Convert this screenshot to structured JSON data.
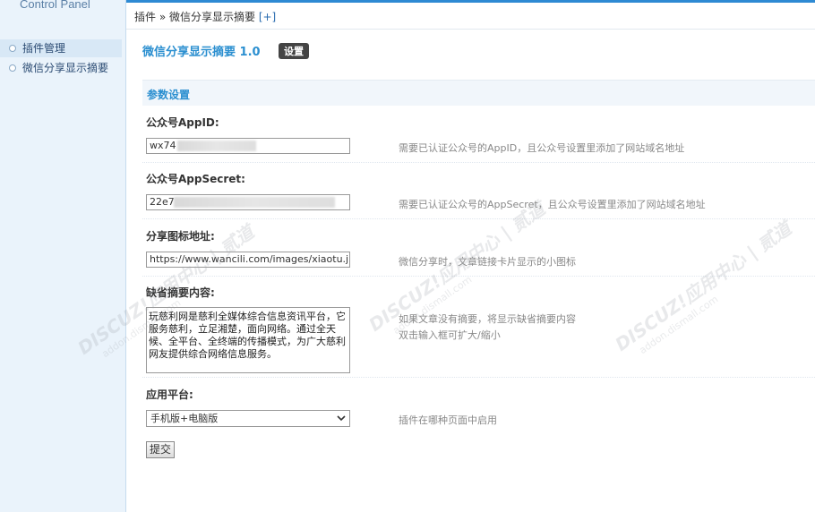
{
  "sidebar": {
    "title": "Control Panel",
    "items": [
      {
        "label": "插件管理"
      },
      {
        "label": "微信分享显示摘要"
      }
    ]
  },
  "breadcrumb": {
    "text": "插件 » 微信分享显示摘要",
    "add": "[+]"
  },
  "page": {
    "title": "微信分享显示摘要 1.0",
    "badge": "设置"
  },
  "section": {
    "title": "参数设置"
  },
  "fields": {
    "appid": {
      "label": "公众号AppID:",
      "value": "wx74",
      "tip": "需要已认证公众号的AppID，且公众号设置里添加了网站域名地址"
    },
    "appsecret": {
      "label": "公众号AppSecret:",
      "value": "22e7",
      "tip": "需要已认证公众号的AppSecret，且公众号设置里添加了网站域名地址"
    },
    "icon": {
      "label": "分享图标地址:",
      "value": "https://www.wancili.com/images/xiaotu.j",
      "tip": "微信分享时，文章链接卡片显示的小图标"
    },
    "summary": {
      "label": "缺省摘要内容:",
      "value": "玩慈利网是慈利全媒体综合信息资讯平台，它服务慈利，立足湘楚，面向网络。通过全天候、全平台、全终端的传播模式，为广大慈利网友提供综合网络信息服务。",
      "tip": "如果文章没有摘要，将显示缺省摘要内容",
      "tip2": "双击输入框可扩大/缩小"
    },
    "platform": {
      "label": "应用平台:",
      "value": "手机版+电脑版",
      "tip": "插件在哪种页面中启用"
    }
  },
  "submit": {
    "label": "提交"
  },
  "watermark": {
    "text": "DISCUZ!应用中心 | 贰道",
    "url": "addon.dismall.com"
  }
}
